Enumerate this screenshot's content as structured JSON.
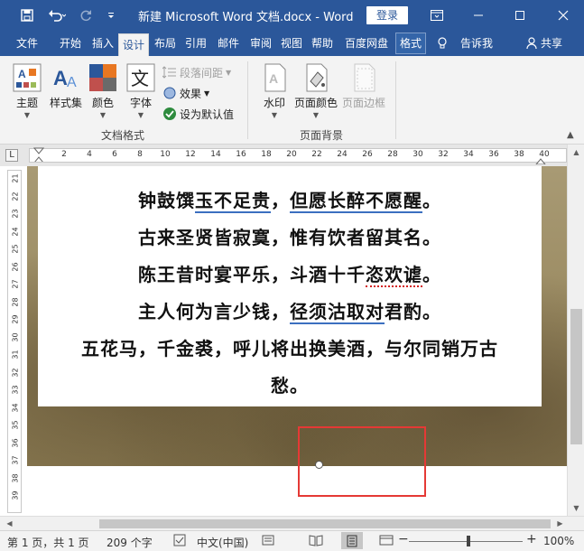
{
  "title_bar": {
    "title": "新建 Microsoft Word 文档.docx  -  Word",
    "login_label": "登录",
    "window_controls": [
      "ribbon-display-icon",
      "minimize-icon",
      "maximize-icon",
      "close-icon"
    ]
  },
  "quick_access": [
    "save-icon",
    "undo-icon",
    "redo-icon",
    "customize-icon"
  ],
  "tabs": [
    "文件",
    "开始",
    "插入",
    "设计",
    "布局",
    "引用",
    "邮件",
    "审阅",
    "视图",
    "帮助",
    "百度网盘",
    "格式",
    "告诉我",
    "共享"
  ],
  "active_tab": "设计",
  "ribbon": {
    "document_format": {
      "theme": "主题",
      "style_set": "样式集",
      "colors": "颜色",
      "fonts": "字体",
      "paragraph_spacing": "段落间距",
      "effects": "效果",
      "set_default": "设为默认值",
      "group_label": "文档格式"
    },
    "page_background": {
      "watermark": "水印",
      "page_color": "页面颜色",
      "page_borders": "页面边框",
      "group_label": "页面背景"
    }
  },
  "ruler": {
    "h_numbers": [
      "2",
      "4",
      "6",
      "8",
      "10",
      "12",
      "14",
      "16",
      "18",
      "20",
      "22",
      "24",
      "26",
      "28",
      "30",
      "32",
      "34",
      "36",
      "38",
      "40"
    ],
    "tab_selector": "L",
    "v_numbers": [
      "21",
      "22",
      "23",
      "24",
      "25",
      "26",
      "27",
      "28",
      "29",
      "30",
      "31",
      "32",
      "33",
      "34",
      "35",
      "36",
      "37",
      "38",
      "39"
    ]
  },
  "document": {
    "line1": {
      "a": "钟鼓馔",
      "b": "玉不足贵",
      "c": "，",
      "d": "但愿长醉不愿醒",
      "e": "。"
    },
    "line2": "古来圣贤皆寂寞，惟有饮者留其名。",
    "line3": {
      "a": "陈王昔时宴平乐，斗酒十千",
      "b": "恣欢谑",
      "c": "。"
    },
    "line4": {
      "a": "主人何为言少钱，",
      "b": "径须沽取对",
      "c": "君酌。"
    },
    "line5": "五花马，千金裘，呼儿将出换美酒，与尔同销万古",
    "line6": "愁。"
  },
  "status_bar": {
    "page": "第 1 页，共 1 页",
    "words": "209 个字",
    "language": "中文(中国)",
    "zoom": "100%",
    "zoom_minus": "−",
    "zoom_plus": "+"
  },
  "colors": {
    "accent": "#2b579a",
    "highlight_box": "#e53935",
    "spell_underline": "#d32020",
    "grammar_underline": "#3b6fc0"
  }
}
